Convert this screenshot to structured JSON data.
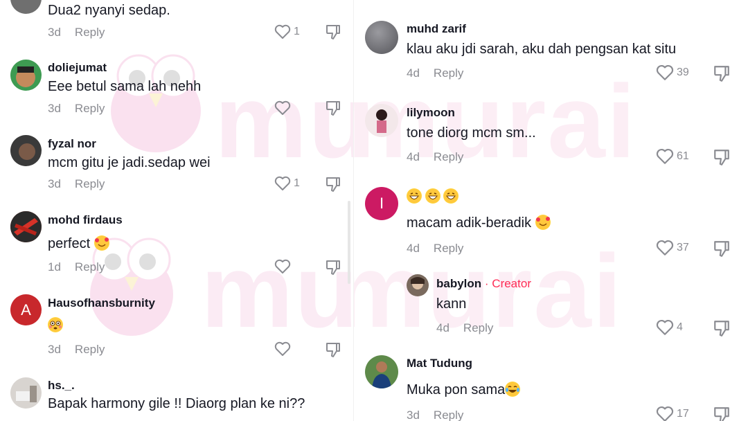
{
  "watermark": "murai",
  "left_comments": [
    {
      "author": "",
      "text": "Dua2 nyanyi sedap.",
      "age": "3d",
      "reply": "Reply",
      "likes": "1"
    },
    {
      "author": "doliejumat",
      "text": "Eee betul sama lah nehh",
      "age": "3d",
      "reply": "Reply",
      "likes": ""
    },
    {
      "author": "fyzal nor",
      "text": "mcm gitu je jadi.sedap wei",
      "age": "3d",
      "reply": "Reply",
      "likes": "1"
    },
    {
      "author": "mohd firdaus",
      "text": "perfect",
      "age": "1d",
      "reply": "Reply",
      "likes": ""
    },
    {
      "author": "Hausofhansburnity",
      "text": "",
      "age": "3d",
      "reply": "Reply",
      "likes": "",
      "avatar_letter": "A"
    },
    {
      "author": "hs._.",
      "text": "Bapak harmony gile !! Diaorg plan ke ni??",
      "age": "",
      "reply": "",
      "likes": ""
    }
  ],
  "right_comments": [
    {
      "author": "muhd zarif",
      "text": "klau aku jdi sarah, aku dah pengsan kat situ",
      "age": "4d",
      "reply": "Reply",
      "likes": "39"
    },
    {
      "author": "lilymoon",
      "text": "tone diorg mcm sm...",
      "age": "4d",
      "reply": "Reply",
      "likes": "61"
    },
    {
      "author": "",
      "text": "macam adik-beradik",
      "age": "4d",
      "reply": "Reply",
      "likes": "37",
      "avatar_letter": "I"
    },
    {
      "author": "babylon",
      "badge": "· Creator",
      "text": "kann",
      "age": "4d",
      "reply": "Reply",
      "likes": "4"
    },
    {
      "author": "Mat Tudung",
      "text": "Muka pon sama",
      "age": "3d",
      "reply": "Reply",
      "likes": "17"
    }
  ],
  "colors": {
    "creator_badge": "#fe2c55",
    "letter_avatar_red": "#c8282c",
    "letter_avatar_pink": "#cc1a63"
  }
}
